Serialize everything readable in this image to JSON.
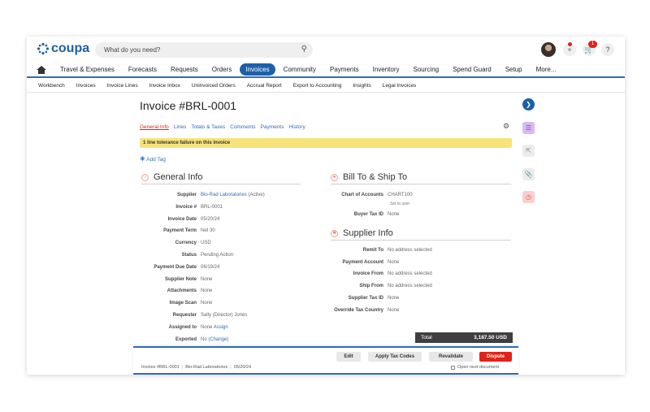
{
  "app": {
    "logo": "coupa",
    "brand_color": "#1d5fa8"
  },
  "search": {
    "placeholder": "What do you need?"
  },
  "header": {
    "cart_badge": "1"
  },
  "main_nav": [
    "Travel & Expenses",
    "Forecasts",
    "Requests",
    "Orders",
    "Invoices",
    "Community",
    "Payments",
    "Inventory",
    "Sourcing",
    "Spend Guard",
    "Setup",
    "More..."
  ],
  "main_nav_active": "Invoices",
  "sub_nav": [
    "Workbench",
    "Invoices",
    "Invoice Lines",
    "Invoice Inbox",
    "Uninvoiced Orders",
    "Accrual Report",
    "Export to Accounting",
    "Insights",
    "Legal Invoices"
  ],
  "page": {
    "title": "Invoice #BRL-0001",
    "tabs": [
      "General Info",
      "Lines",
      "Totals & Taxes",
      "Comments",
      "Payments",
      "History"
    ],
    "tolerance_message": "1 line tolerance failure on this invoice",
    "add_tag": "Add Tag"
  },
  "general_info": {
    "heading": "General Info",
    "rows": [
      {
        "label": "Supplier",
        "value": "Bio-Rad Laboratories",
        "extra": "(Active)"
      },
      {
        "label": "Invoice #",
        "value": "BRL-0001"
      },
      {
        "label": "Invoice Date",
        "value": "05/20/24"
      },
      {
        "label": "Payment Term",
        "value": "Net 30"
      },
      {
        "label": "Currency",
        "value": "USD"
      },
      {
        "label": "Status",
        "value": "Pending Action"
      },
      {
        "label": "Payment Due Date",
        "value": "06/19/24"
      },
      {
        "label": "Supplier Note",
        "value": "None"
      },
      {
        "label": "Attachments",
        "value": "None"
      },
      {
        "label": "Image Scan",
        "value": "None"
      },
      {
        "label": "Requester",
        "value": "Sally (Director) Jones"
      },
      {
        "label": "Assigned to",
        "value": "None",
        "link": "Assign"
      },
      {
        "label": "Exported",
        "value": "No",
        "link": "(Change)"
      }
    ]
  },
  "bill_to": {
    "heading": "Bill To & Ship To",
    "chart_of_accounts_label": "Chart of Accounts",
    "chart_of_accounts_value": "CHART100",
    "chart_of_accounts_sub": "Set to user",
    "buyer_tax_label": "Buyer Tax ID",
    "buyer_tax_value": "None"
  },
  "supplier_info": {
    "heading": "Supplier Info",
    "rows": [
      {
        "label": "Remit To",
        "value": "No address selected"
      },
      {
        "label": "Payment Account",
        "value": "None"
      },
      {
        "label": "Invoice From",
        "value": "No address selected"
      },
      {
        "label": "Ship From",
        "value": "No address selected"
      },
      {
        "label": "Supplier Tax ID",
        "value": "None"
      },
      {
        "label": "Override Tax Country",
        "value": "None"
      }
    ]
  },
  "total": {
    "label": "Total",
    "value": "3,187.50 USD"
  },
  "actions": {
    "edit": "Edit",
    "apply_tax": "Apply Tax Codes",
    "revalidate": "Revalidate",
    "dispute": "Dispute",
    "summary_invoice": "Invoice #BRL-0001",
    "summary_supplier": "Bio-Rad Laboratories",
    "summary_date": "05/20/24",
    "open_next": "Open next document"
  }
}
